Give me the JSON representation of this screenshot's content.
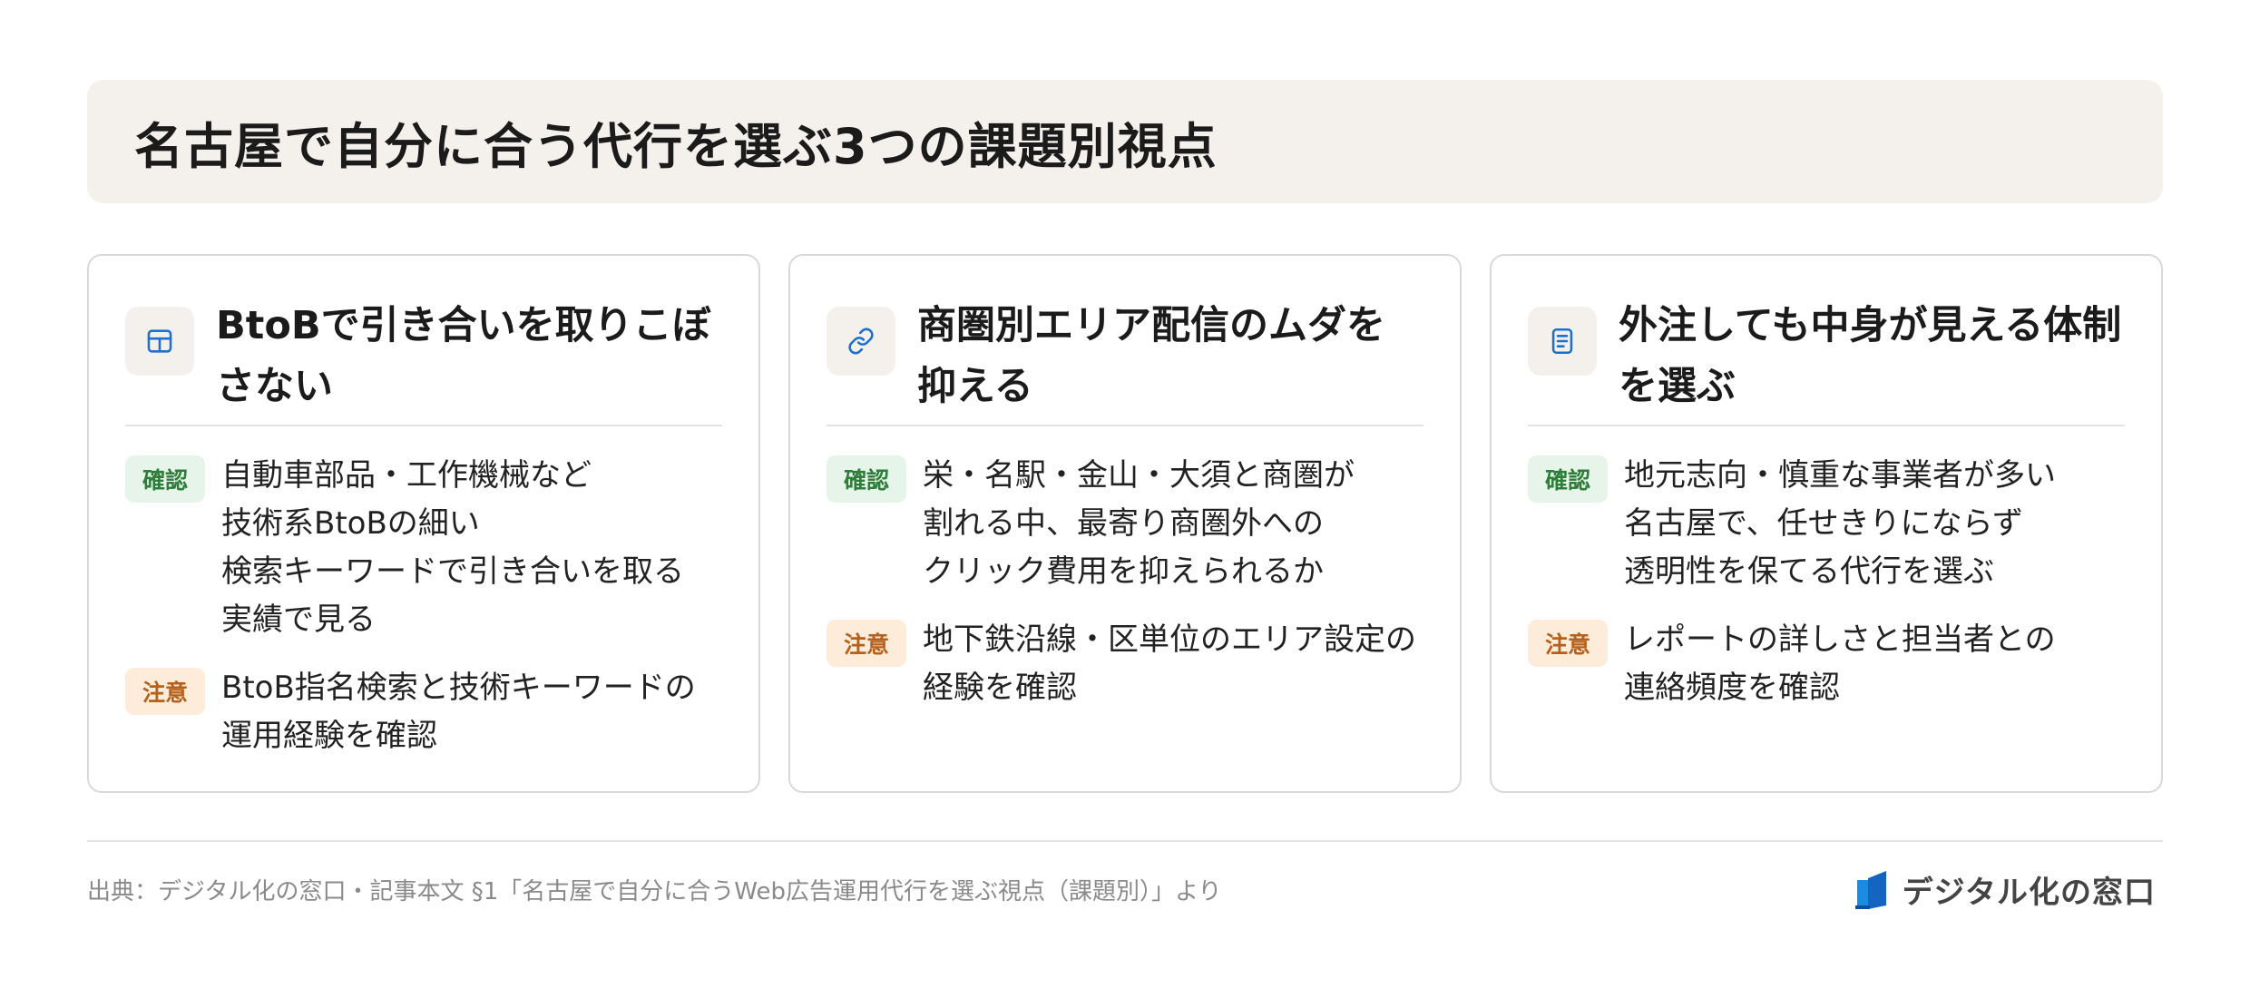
{
  "title": "名古屋で自分に合う代行を選ぶ3つの課題別視点",
  "colors": {
    "banner_bg": "#f4f1ec",
    "icon_blue": "#1f6fd1",
    "check_bg": "#e6f4ea",
    "check_text": "#2e7d3a",
    "warn_bg": "#fcecd9",
    "warn_text": "#b5611b"
  },
  "cards": [
    {
      "icon": "table-icon",
      "title": "BtoBで引き合いを取りこぼさない",
      "check_label": "確認",
      "check_text": "自動車部品・工作機械など\n技術系BtoBの細い\n検索キーワードで引き合いを取る\n実績で見る",
      "warn_label": "注意",
      "warn_text": "BtoB指名検索と技術キーワードの\n運用経験を確認"
    },
    {
      "icon": "link-icon",
      "title": "商圏別エリア配信のムダを抑える",
      "check_label": "確認",
      "check_text": "栄・名駅・金山・大須と商圏が\n割れる中、最寄り商圏外への\nクリック費用を抑えられるか",
      "warn_label": "注意",
      "warn_text": "地下鉄沿線・区単位のエリア設定の\n経験を確認"
    },
    {
      "icon": "document-icon",
      "title": "外注しても中身が見える体制を選ぶ",
      "check_label": "確認",
      "check_text": "地元志向・慎重な事業者が多い\n名古屋で、任せきりにならず\n透明性を保てる代行を選ぶ",
      "warn_label": "注意",
      "warn_text": "レポートの詳しさと担当者との\n連絡頻度を確認"
    }
  ],
  "footer": {
    "source": "出典：デジタル化の窓口・記事本文 §1「名古屋で自分に合うWeb広告運用代行を選ぶ視点（課題別）」より",
    "brand_name": "デジタル化の窓口",
    "brand_icon": "brand-logo-icon"
  }
}
